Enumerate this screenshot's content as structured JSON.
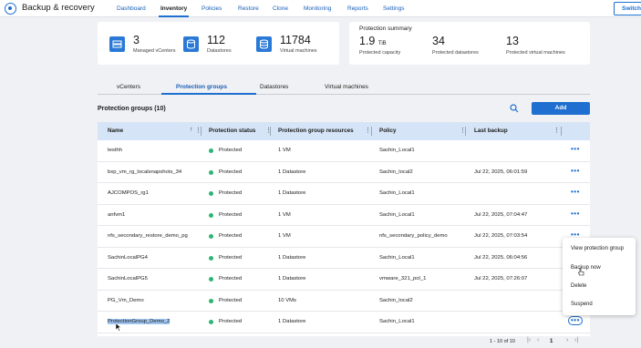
{
  "app": {
    "title": "Backup & recovery",
    "switch_label": "Switch"
  },
  "nav": [
    "Dashboard",
    "Inventory",
    "Policies",
    "Restore",
    "Clone",
    "Monitoring",
    "Reports",
    "Settings"
  ],
  "inventory": {
    "vcenters": {
      "value": "3",
      "label": "Managed vCenters"
    },
    "datastores": {
      "value": "112",
      "label": "Datastores"
    },
    "vms": {
      "value": "11784",
      "label": "Virtual machines"
    }
  },
  "protection_summary": {
    "title": "Protection summary",
    "capacity": {
      "value": "1.9",
      "unit": "TiB",
      "label": "Protected capacity"
    },
    "datastores": {
      "value": "34",
      "label": "Protected datastores"
    },
    "vms": {
      "value": "13",
      "label": "Protected virtual machines"
    }
  },
  "tabs": [
    "vCenters",
    "Protection groups",
    "Datastores",
    "Virtual machines"
  ],
  "section": {
    "title": "Protection groups (10)",
    "add_label": "Add"
  },
  "columns": [
    "Name",
    "Protection status",
    "Protection group resources",
    "Policy",
    "Last backup"
  ],
  "rows": [
    {
      "name": "testhh",
      "status": "Protected",
      "resources": "1 VM",
      "policy": "Sachin_Local1",
      "last_backup": ""
    },
    {
      "name": "bxp_vm_rg_localsnapshots_34",
      "status": "Protected",
      "resources": "1 Datastore",
      "policy": "Sachin_local2",
      "last_backup": "Jul 22, 2025, 06:01:59"
    },
    {
      "name": "AJCOMPOS_rg1",
      "status": "Protected",
      "resources": "1 Datastore",
      "policy": "Sachin_Local1",
      "last_backup": ""
    },
    {
      "name": "anfvm1",
      "status": "Protected",
      "resources": "1 VM",
      "policy": "Sachin_Local1",
      "last_backup": "Jul 22, 2025, 07:04:47"
    },
    {
      "name": "nfs_secondary_restore_demo_pg",
      "status": "Protected",
      "resources": "1 VM",
      "policy": "nfs_secondary_policy_demo",
      "last_backup": "Jul 22, 2025, 07:03:54"
    },
    {
      "name": "SachinLocalPG4",
      "status": "Protected",
      "resources": "1 Datastore",
      "policy": "Sachin_Local1",
      "last_backup": "Jul 22, 2025, 06:04:56"
    },
    {
      "name": "SachinLocalPG5",
      "status": "Protected",
      "resources": "1 Datastore",
      "policy": "vmware_321_pol_1",
      "last_backup": "Jul 22, 2025, 07:26:07"
    },
    {
      "name": "PG_Vm_Demo",
      "status": "Protected",
      "resources": "10 VMs",
      "policy": "Sachin_local2",
      "last_backup": ""
    },
    {
      "name": "ProtectionGroup_Demo_2",
      "status": "Protected",
      "resources": "1 Datastore",
      "policy": "Sachin_Local1",
      "last_backup": ""
    }
  ],
  "pagination": {
    "range": "1 - 10 of 10",
    "page": "1"
  },
  "context_menu": [
    "View protection group",
    "Backup now",
    "Delete",
    "Suspend"
  ],
  "colors": {
    "accent": "#1e6fd0",
    "header_bg": "#d5e5f7",
    "status_ok": "#2bb673"
  }
}
